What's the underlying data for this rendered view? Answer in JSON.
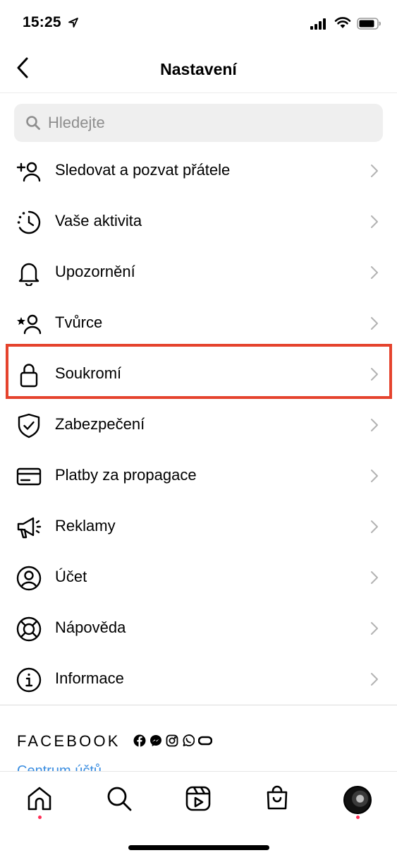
{
  "status_bar": {
    "time": "15:25"
  },
  "header": {
    "title": "Nastavení"
  },
  "search": {
    "placeholder": "Hledejte",
    "value": ""
  },
  "menu": {
    "items": [
      {
        "label": "Sledovat a pozvat přátele",
        "icon": "add-person-icon"
      },
      {
        "label": "Vaše aktivita",
        "icon": "activity-clock-icon"
      },
      {
        "label": "Upozornění",
        "icon": "bell-icon"
      },
      {
        "label": "Tvůrce",
        "icon": "creator-star-icon"
      },
      {
        "label": "Soukromí",
        "icon": "lock-icon"
      },
      {
        "label": "Zabezpečení",
        "icon": "shield-check-icon"
      },
      {
        "label": "Platby za propagace",
        "icon": "credit-card-icon"
      },
      {
        "label": "Reklamy",
        "icon": "megaphone-icon"
      },
      {
        "label": "Účet",
        "icon": "account-circle-icon"
      },
      {
        "label": "Nápověda",
        "icon": "lifebuoy-icon"
      },
      {
        "label": "Informace",
        "icon": "info-icon"
      }
    ],
    "highlighted_item": "Soukromí",
    "highlight_color": "#e5432d"
  },
  "facebook": {
    "brand": "FACEBOOK",
    "link": "Centrum účtů"
  },
  "tabbar": {
    "tabs": [
      "home-icon",
      "search-icon",
      "reels-icon",
      "shop-icon",
      "profile-avatar"
    ],
    "notification_dot_color": "#ff2d55"
  },
  "colors": {
    "link": "#3a8de0",
    "search_bg": "#efefef"
  }
}
